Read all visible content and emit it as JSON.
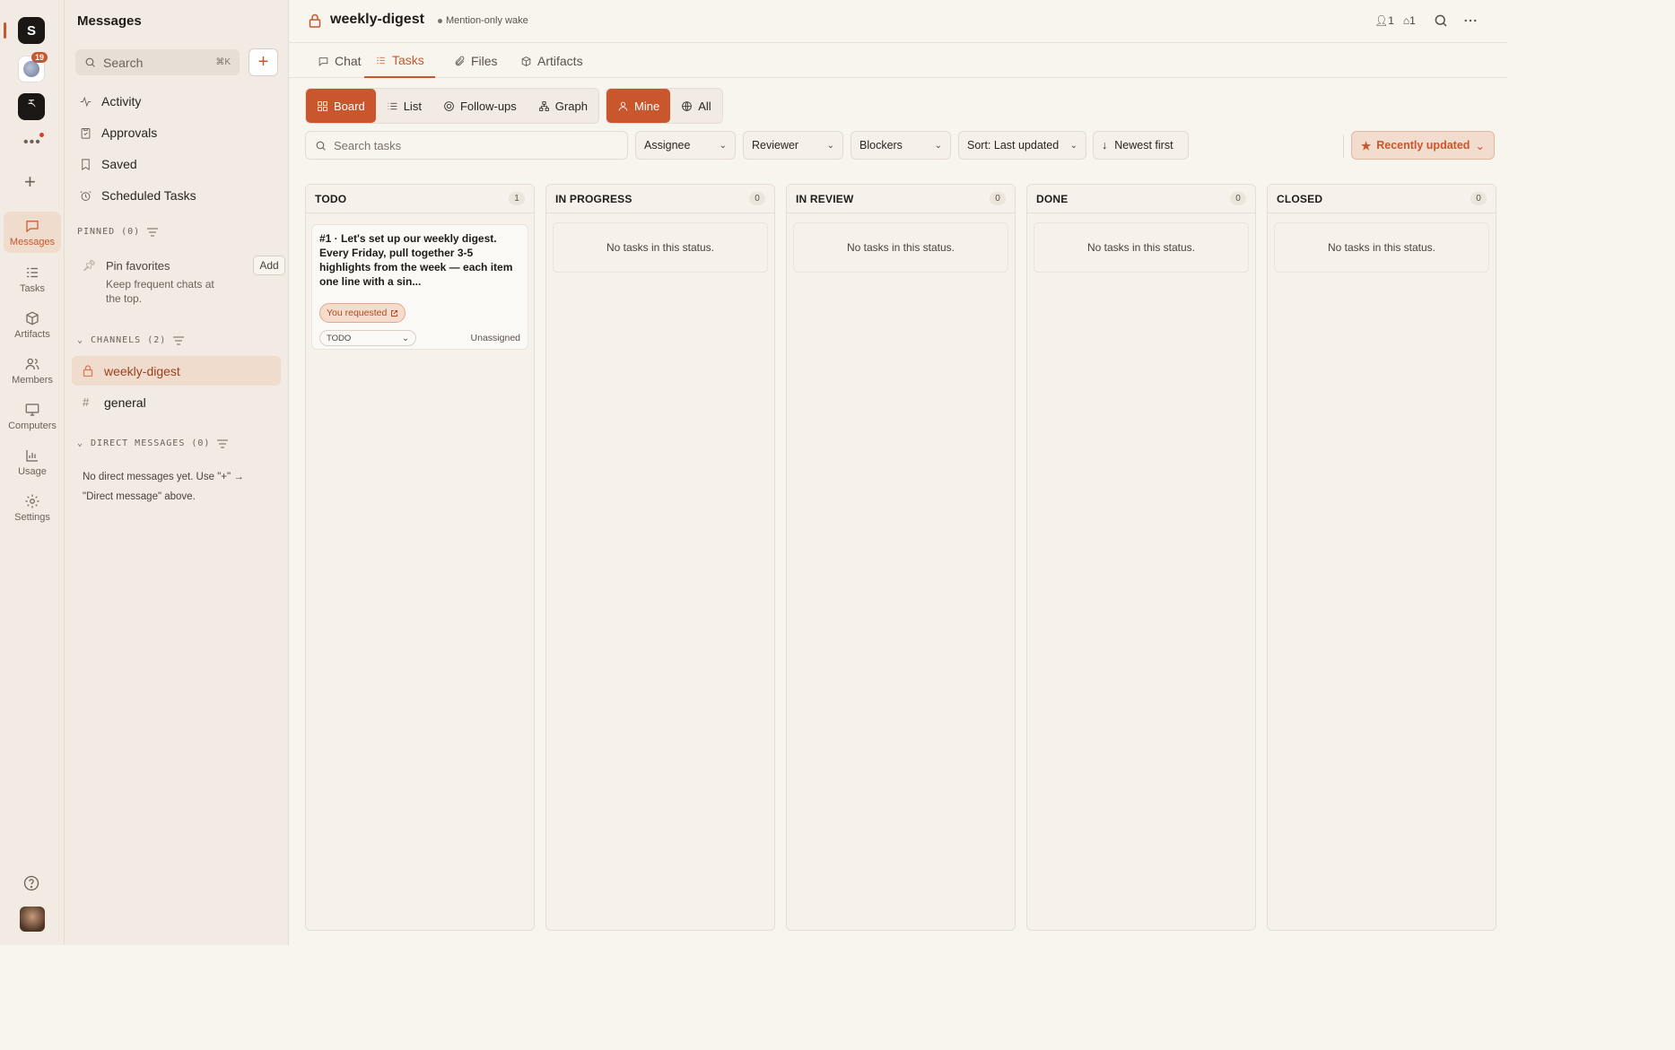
{
  "rail": {
    "workspace_initial": "S",
    "workspace2_badge": "19",
    "workspace3_glyph": "ར",
    "more_label": "•••",
    "plus_label": "+",
    "nav": [
      {
        "label": "Messages",
        "icon": "message-icon"
      },
      {
        "label": "Tasks",
        "icon": "tasks-icon"
      },
      {
        "label": "Artifacts",
        "icon": "cube-icon"
      },
      {
        "label": "Members",
        "icon": "members-icon"
      },
      {
        "label": "Computers",
        "icon": "monitor-icon"
      },
      {
        "label": "Usage",
        "icon": "chart-icon"
      },
      {
        "label": "Settings",
        "icon": "gear-icon"
      }
    ]
  },
  "sidebar": {
    "title": "Messages",
    "search_placeholder": "Search",
    "search_shortcut": "⌘K",
    "add_label": "+",
    "links": [
      {
        "label": "Activity",
        "icon": "activity-icon"
      },
      {
        "label": "Approvals",
        "icon": "clipboard-icon"
      },
      {
        "label": "Saved",
        "icon": "bookmark-icon"
      },
      {
        "label": "Scheduled Tasks",
        "icon": "clock-icon"
      }
    ],
    "pinned_header": "PINNED (0)",
    "pin_title": "Pin favorites",
    "pin_sub": "Keep frequent chats at the top.",
    "pin_add": "Add",
    "channels_header": "CHANNELS (2)",
    "channels": [
      {
        "name": "weekly-digest",
        "symbol": "lock",
        "active": true
      },
      {
        "name": "general",
        "symbol": "#",
        "active": false
      }
    ],
    "dm_header": "DIRECT MESSAGES (0)",
    "dm_empty": "No direct messages yet. Use \"+\" → \"Direct message\" above."
  },
  "header": {
    "channel": "weekly-digest",
    "wake": "Mention-only wake",
    "members_count": "1",
    "bots_count": "1"
  },
  "tabs": [
    {
      "label": "Chat",
      "active": false
    },
    {
      "label": "Tasks",
      "active": true
    },
    {
      "label": "Files",
      "active": false
    },
    {
      "label": "Artifacts",
      "active": false
    }
  ],
  "views": {
    "board": "Board",
    "list": "List",
    "followups": "Follow-ups",
    "graph": "Graph",
    "mine": "Mine",
    "all": "All"
  },
  "filters": {
    "search_placeholder": "Search tasks",
    "assignee": "Assignee",
    "reviewer": "Reviewer",
    "blockers": "Blockers",
    "sort": "Sort: Last updated",
    "order": "Newest first",
    "recent": "Recently updated"
  },
  "colors": {
    "accent": "#c9562c",
    "sidebar_bg": "#f1ebe3",
    "page_bg": "#f8f4ee"
  },
  "columns": [
    {
      "name": "TODO",
      "count": "1"
    },
    {
      "name": "IN PROGRESS",
      "count": "0",
      "empty": "No tasks in this status."
    },
    {
      "name": "IN REVIEW",
      "count": "0",
      "empty": "No tasks in this status."
    },
    {
      "name": "DONE",
      "count": "0",
      "empty": "No tasks in this status."
    },
    {
      "name": "CLOSED",
      "count": "0",
      "empty": "No tasks in this status."
    }
  ],
  "task": {
    "title": "#1 · Let's set up our weekly digest. Every Friday, pull together 3-5 highlights from the week — each item one line with a sin...",
    "chip": "You requested",
    "status": "TODO",
    "assignee": "Unassigned"
  }
}
